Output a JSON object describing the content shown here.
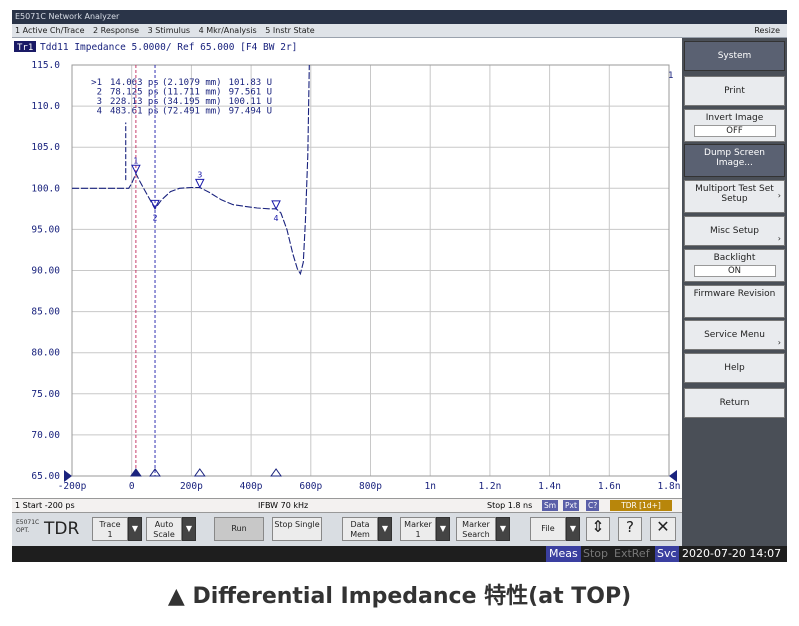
{
  "window": {
    "title": "E5071C Network Analyzer",
    "resize": "Resize"
  },
  "menu": [
    "1 Active Ch/Trace",
    "2 Response",
    "3 Stimulus",
    "4 Mkr/Analysis",
    "5 Instr State"
  ],
  "trace_header": {
    "tag": "Tr1",
    "text": "Tdd11 Impedance 5.0000/ Ref 65.000 [F4 BW 2r]",
    "right_marker": "1"
  },
  "markers": [
    {
      "id": ">1",
      "time": "14.063 ps",
      "dist": "(2.1079 mm)",
      "value": "101.83 U"
    },
    {
      "id": "2",
      "time": "78.125 ps",
      "dist": "(11.711 mm)",
      "value": "97.561 U"
    },
    {
      "id": "3",
      "time": "228.13 ps",
      "dist": "(34.195 mm)",
      "value": "100.11 U"
    },
    {
      "id": "4",
      "time": "483.61 ps",
      "dist": "(72.491 mm)",
      "value": "97.494 U"
    }
  ],
  "chart_data": {
    "type": "line",
    "title": "Tdd11 Impedance 5.0000/ Ref 65.000",
    "ylabel": "",
    "xlabel": "",
    "ylim": [
      65,
      115
    ],
    "xlim": [
      -200,
      1800
    ],
    "yticks": [
      "115.0",
      "110.0",
      "105.0",
      "100.0",
      "95.00",
      "90.00",
      "85.00",
      "80.00",
      "75.00",
      "70.00",
      "65.00"
    ],
    "xticks": [
      "-200p",
      "0",
      "200p",
      "400p",
      "600p",
      "800p",
      "1n",
      "1.2n",
      "1.4n",
      "1.6n",
      "1.8n"
    ],
    "series": [
      {
        "x": [
          -200,
          -100,
          -40,
          -10,
          0,
          14,
          25,
          40,
          60,
          78,
          100,
          130,
          160,
          200,
          228,
          260,
          300,
          340,
          380,
          420,
          460,
          484,
          500,
          520,
          540,
          555,
          565,
          575,
          582,
          590,
          595
        ],
        "y": [
          100.0,
          100.0,
          100.0,
          100.0,
          100.6,
          101.8,
          101.0,
          100.0,
          98.7,
          97.5,
          98.6,
          99.6,
          100.0,
          100.1,
          100.1,
          99.5,
          98.6,
          98.0,
          97.8,
          97.6,
          97.5,
          97.5,
          97.0,
          95.0,
          92.0,
          90.2,
          89.6,
          91.0,
          96.0,
          104.0,
          115.0
        ]
      }
    ]
  },
  "status": {
    "start": "1 Start -200 ps",
    "ifbw": "IFBW 70 kHz",
    "stop": "Stop 1.8 ns",
    "tags": [
      "Sm",
      "Pxt",
      "C?",
      "TDR [1d+]"
    ]
  },
  "controls": {
    "brand_top": "E5071C",
    "brand_bottom": "OPT.",
    "brand_mode": "TDR",
    "trace": "Trace",
    "trace_val": "1",
    "auto_scale": "Auto Scale",
    "run": "Run",
    "stop_single": "Stop Single",
    "data_mem": "Data Mem",
    "marker": "Marker",
    "marker_val": "1",
    "marker_search": "Marker Search",
    "file": "File"
  },
  "bottom": {
    "meas": "Meas",
    "stop": "Stop",
    "extref": "ExtRef",
    "svc": "Svc",
    "datetime": "2020-07-20 14:07"
  },
  "softkeys": [
    {
      "label": "System"
    },
    {
      "label": "Print"
    },
    {
      "label": "Invert Image",
      "sub": "OFF"
    },
    {
      "label": "Dump Screen Image..."
    },
    {
      "label": "Multiport Test Set Setup"
    },
    {
      "label": "Misc Setup"
    },
    {
      "label": "Backlight",
      "sub": "ON"
    },
    {
      "label": "Firmware Revision"
    },
    {
      "label": "Service Menu"
    },
    {
      "label": "Help"
    },
    {
      "label": "Return"
    }
  ],
  "caption": "▲ Differential Impedance 特性(at TOP)",
  "colors": {
    "trace": "#1a237e",
    "axis": "#1a237e",
    "grid": "#c8c8c8",
    "marker": "#1a1aaa"
  }
}
